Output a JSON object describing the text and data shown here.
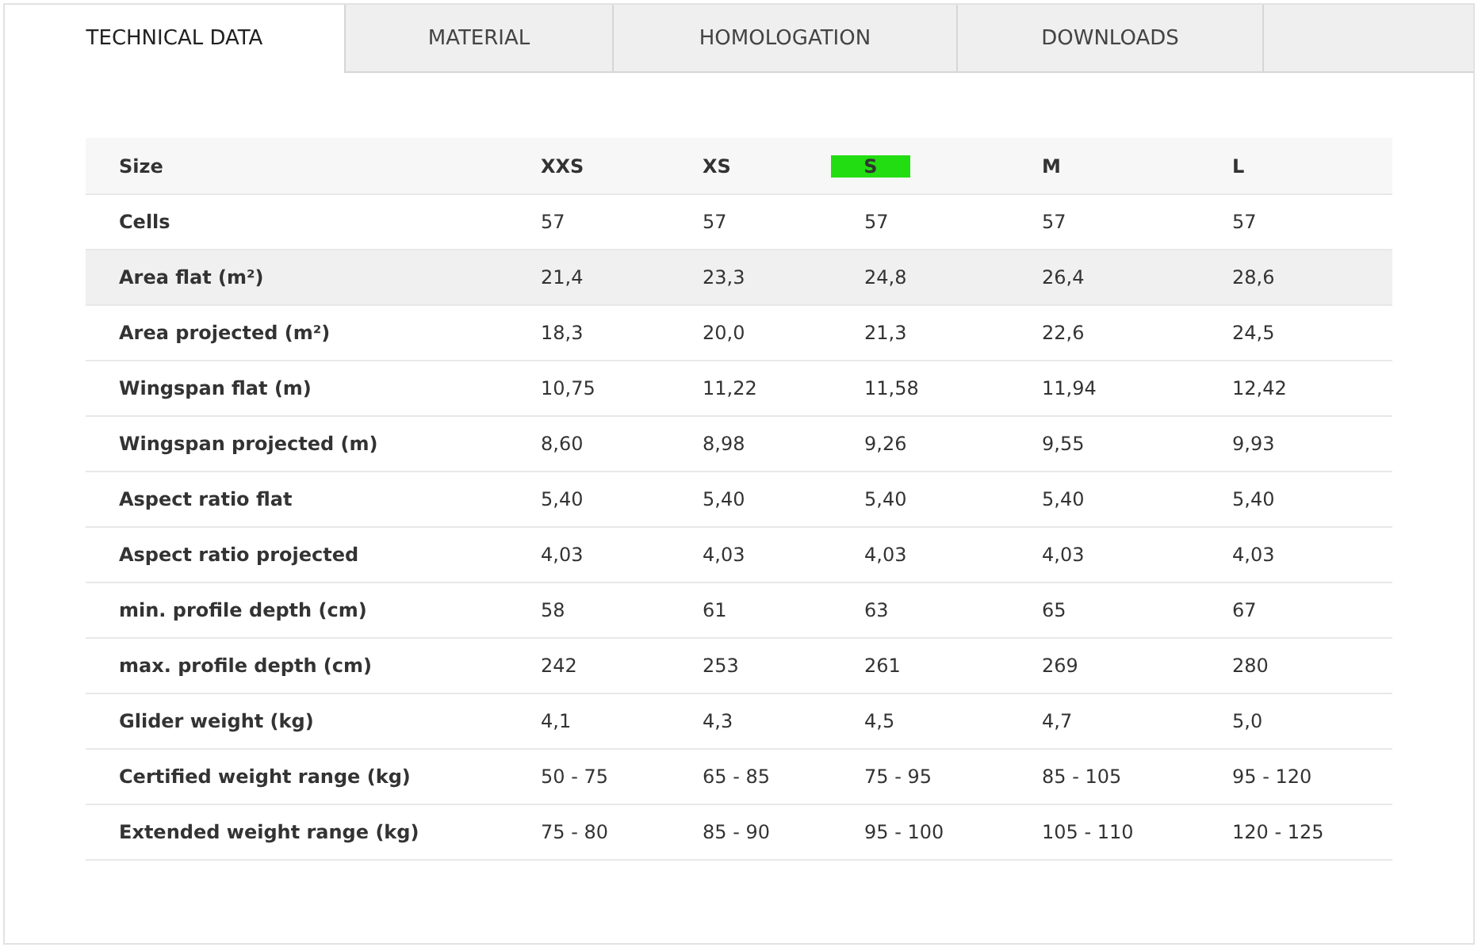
{
  "tabs": [
    {
      "label": "TECHNICAL DATA",
      "selected": true
    },
    {
      "label": "MATERIAL",
      "selected": false
    },
    {
      "label": "HOMOLOGATION",
      "selected": false
    },
    {
      "label": "DOWNLOADS",
      "selected": false
    }
  ],
  "table": {
    "header": {
      "label": "Size",
      "sizes": [
        {
          "label": "XXS",
          "selected": false
        },
        {
          "label": "XS",
          "selected": false
        },
        {
          "label": "S",
          "selected": true
        },
        {
          "label": "M",
          "selected": false
        },
        {
          "label": "L",
          "selected": false
        }
      ]
    },
    "rows": [
      {
        "label": "Cells",
        "values": [
          "57",
          "57",
          "57",
          "57",
          "57"
        ],
        "highlighted": false
      },
      {
        "label": "Area flat (m²)",
        "values": [
          "21,4",
          "23,3",
          "24,8",
          "26,4",
          "28,6"
        ],
        "highlighted": true
      },
      {
        "label": "Area projected (m²)",
        "values": [
          "18,3",
          "20,0",
          "21,3",
          "22,6",
          "24,5"
        ],
        "highlighted": false
      },
      {
        "label": "Wingspan flat (m)",
        "values": [
          "10,75",
          "11,22",
          "11,58",
          "11,94",
          "12,42"
        ],
        "highlighted": false
      },
      {
        "label": "Wingspan projected (m)",
        "values": [
          "8,60",
          "8,98",
          "9,26",
          "9,55",
          "9,93"
        ],
        "highlighted": false
      },
      {
        "label": "Aspect ratio flat",
        "values": [
          "5,40",
          "5,40",
          "5,40",
          "5,40",
          "5,40"
        ],
        "highlighted": false
      },
      {
        "label": "Aspect ratio projected",
        "values": [
          "4,03",
          "4,03",
          "4,03",
          "4,03",
          "4,03"
        ],
        "highlighted": false
      },
      {
        "label": "min. profile depth (cm)",
        "values": [
          "58",
          "61",
          "63",
          "65",
          "67"
        ],
        "highlighted": false
      },
      {
        "label": "max. profile depth (cm)",
        "values": [
          "242",
          "253",
          "261",
          "269",
          "280"
        ],
        "highlighted": false
      },
      {
        "label": "Glider weight (kg)",
        "values": [
          "4,1",
          "4,3",
          "4,5",
          "4,7",
          "5,0"
        ],
        "highlighted": false
      },
      {
        "label": "Certified weight range (kg)",
        "values": [
          "50 - 75",
          "65 - 85",
          "75 - 95",
          "85 - 105",
          "95 - 120"
        ],
        "highlighted": false
      },
      {
        "label": "Extended weight range (kg)",
        "values": [
          "75 - 80",
          "85 - 90",
          "95 - 100",
          "105 - 110",
          "120 - 125"
        ],
        "highlighted": false
      }
    ]
  }
}
